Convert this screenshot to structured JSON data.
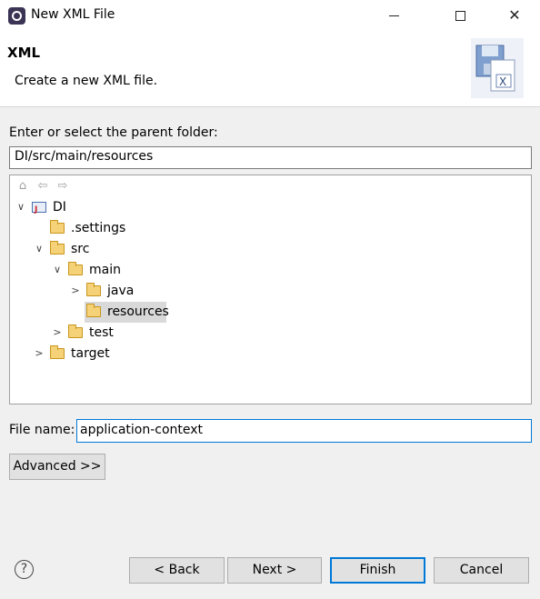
{
  "window": {
    "title": "New XML File",
    "min_icon": "minimize-icon",
    "max_icon": "maximize-icon",
    "close_icon": "close-icon",
    "close_glyph": "✕"
  },
  "header": {
    "heading": "XML",
    "description": "Create a new XML file.",
    "banner_icon": "xml-file-wizard-icon"
  },
  "folder": {
    "label": "Enter or select the parent folder:",
    "value": "DI/src/main/resources"
  },
  "tree": {
    "toolbar": {
      "home_glyph": "⌂",
      "back_glyph": "⇦",
      "forward_glyph": "⇨"
    },
    "nodes": [
      {
        "label": "DI",
        "expanded": true,
        "icon": "java-project-icon"
      },
      {
        "label": ".settings",
        "icon": "folder-icon"
      },
      {
        "label": "src",
        "expanded": true,
        "icon": "folder-icon"
      },
      {
        "label": "main",
        "expanded": true,
        "icon": "folder-icon"
      },
      {
        "label": "java",
        "expanded": false,
        "icon": "folder-icon"
      },
      {
        "label": "resources",
        "selected": true,
        "icon": "folder-icon"
      },
      {
        "label": "test",
        "expanded": false,
        "icon": "folder-icon"
      },
      {
        "label": "target",
        "expanded": false,
        "icon": "folder-icon"
      }
    ],
    "expanded_glyph": "∨",
    "collapsed_glyph": ">"
  },
  "file": {
    "label": "File name:",
    "value": "application-context"
  },
  "buttons": {
    "advanced": "Advanced >>",
    "back": "< Back",
    "next": "Next >",
    "finish": "Finish",
    "cancel": "Cancel",
    "help": "?"
  },
  "colors": {
    "accent": "#0078d7",
    "selection": "#d9d9d9",
    "folder": "#f5d278"
  }
}
